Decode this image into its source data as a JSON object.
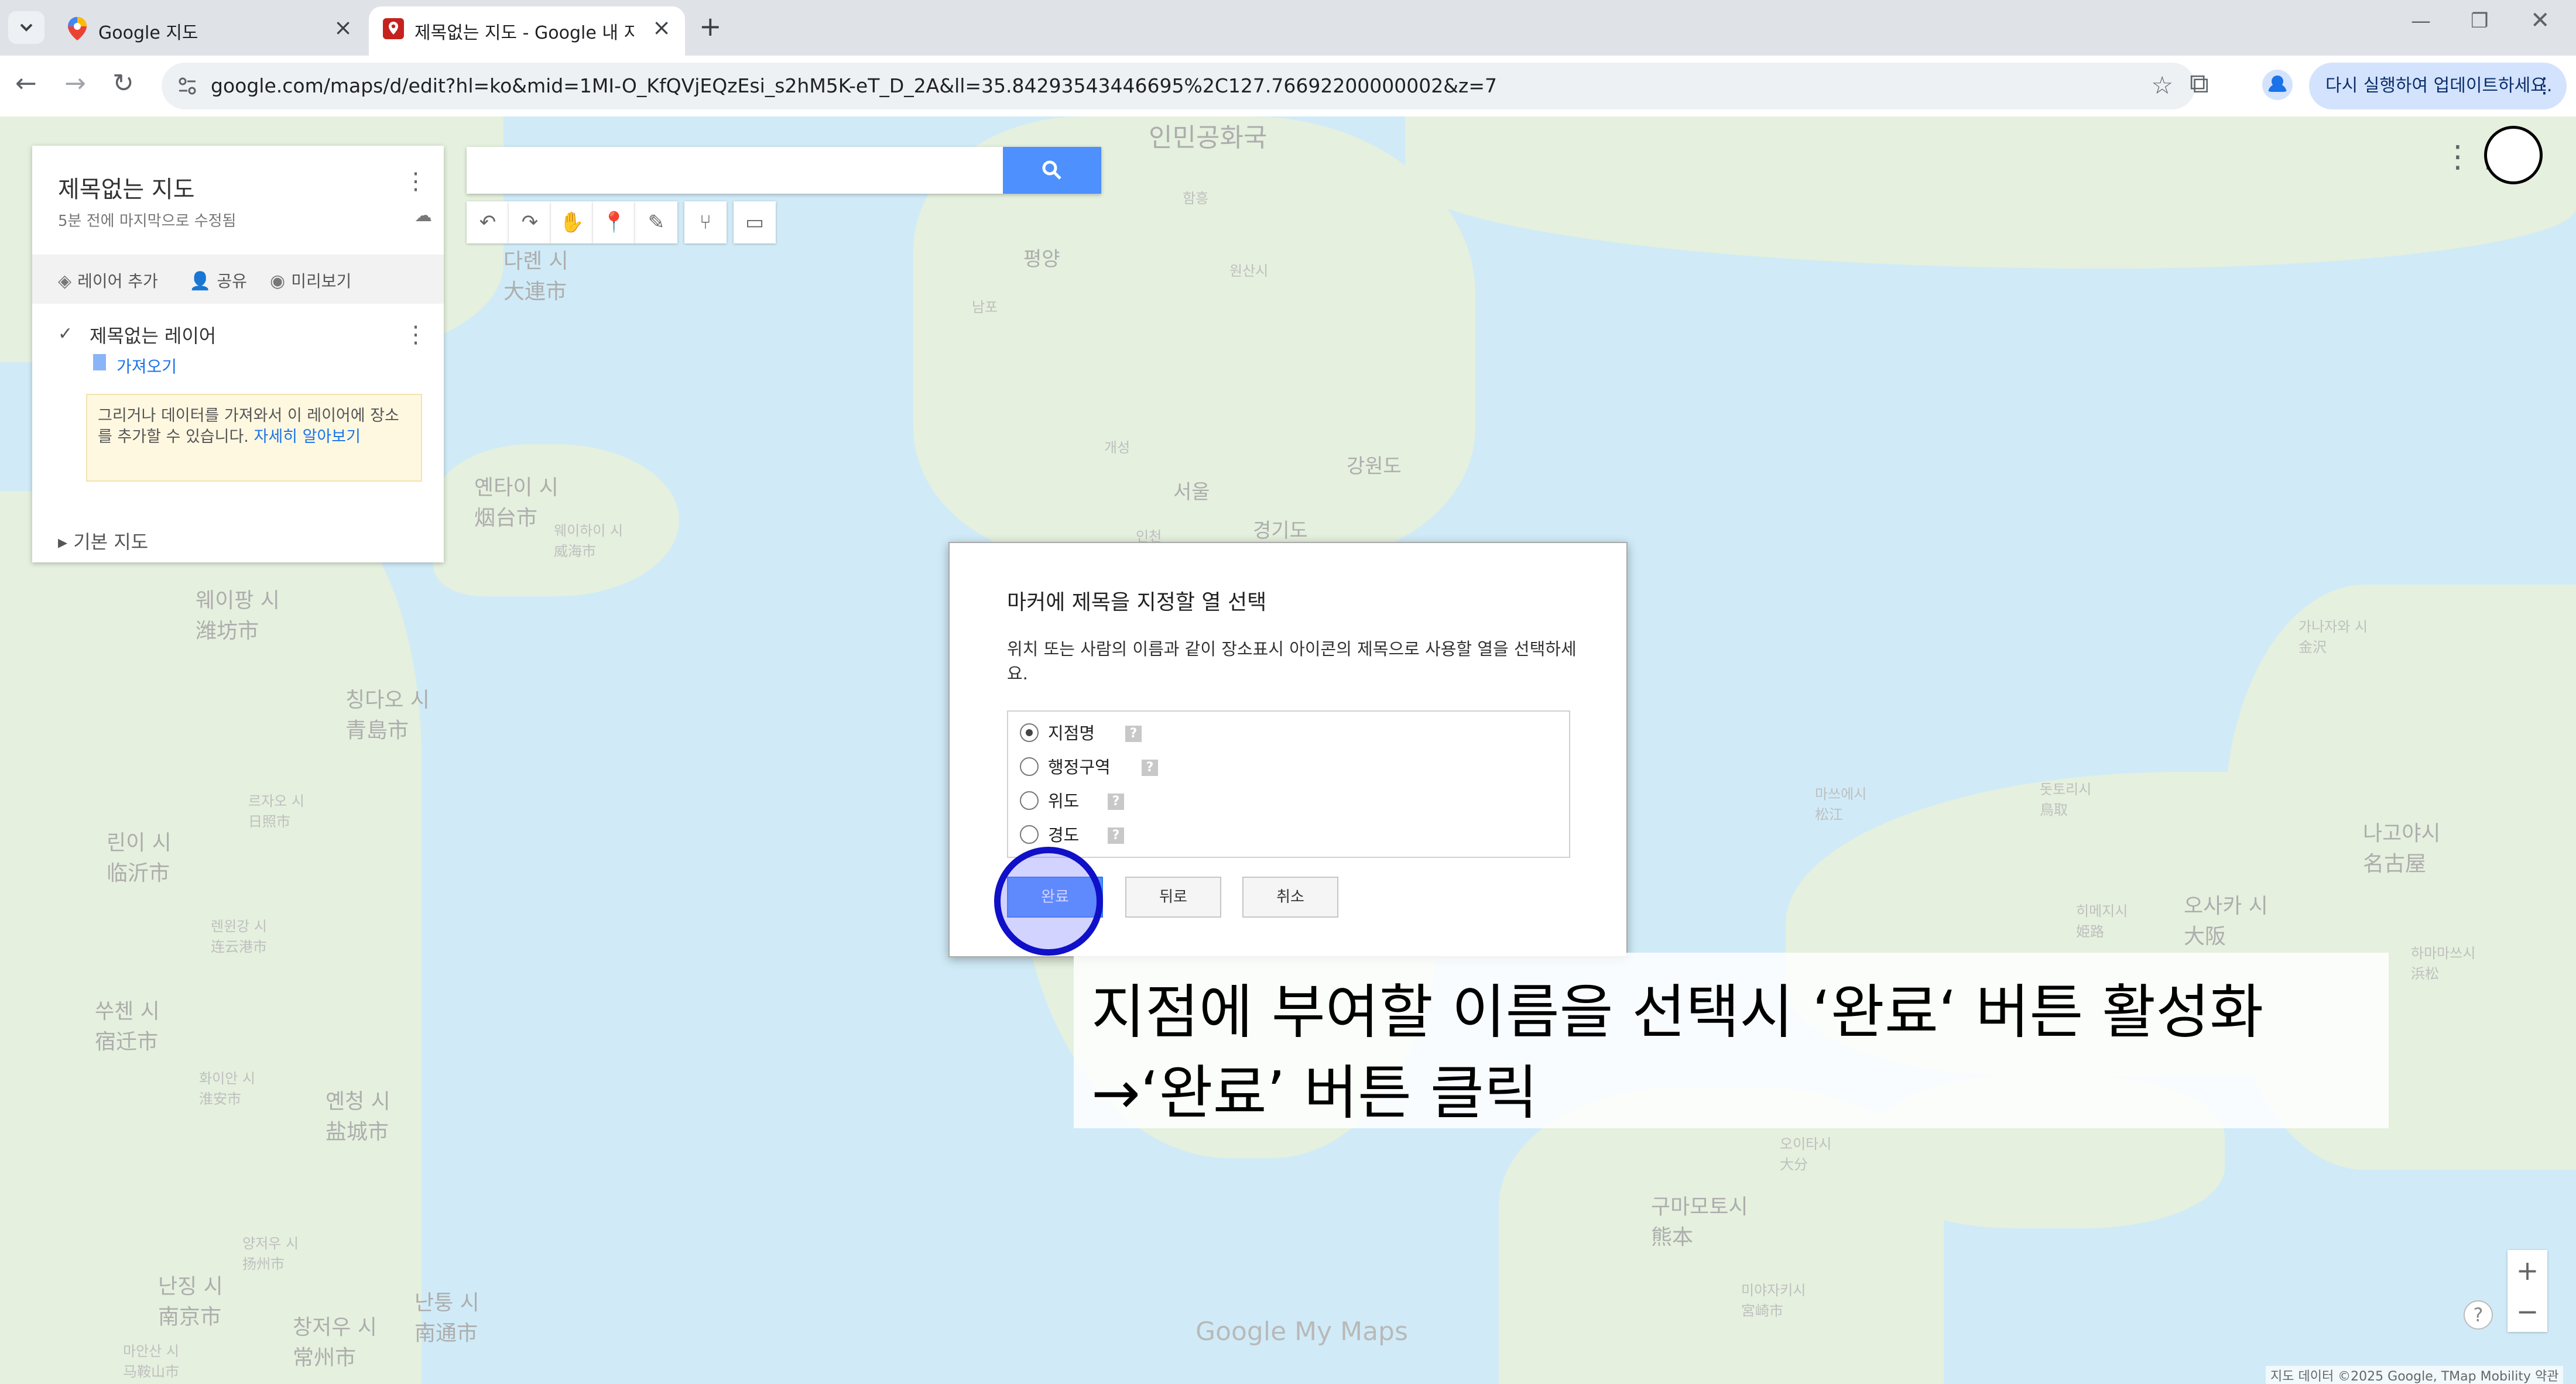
{
  "browser": {
    "tabs": [
      {
        "title": "Google 지도",
        "active": false
      },
      {
        "title": "제목없는 지도 - Google 내 지도",
        "active": true
      }
    ],
    "url": "google.com/maps/d/edit?hl=ko&mid=1MI-O_KfQVjEQzEsi_s2hM5K-eT_D_2A&ll=35.84293543446695%2C127.76692200000002&z=7",
    "update_button": "다시 실행하여 업데이트하세요."
  },
  "panel": {
    "map_title": "제목없는 지도",
    "saved_status": "5분 전에 마지막으로 수정됨",
    "actions": {
      "add_layer": "레이어 추가",
      "share": "공유",
      "preview": "미리보기"
    },
    "layer_name": "제목없는 레이어",
    "import_label": "가져오기",
    "hint_text": "그리거나 데이터를 가져와서 이 레이어에 장소를 추가할 수 있습니다.",
    "hint_link": "자세히 알아보기",
    "basemap_label": "기본 지도"
  },
  "map_labels": {
    "dalian": "다롄 시\n大連市",
    "yantai": "옌타이 시\n烟台市",
    "weihai": "웨이하이 시\n威海市",
    "weifang": "웨이팡 시\n潍坊市",
    "qingdao": "칭다오 시\n青島市",
    "rizhao": "르자오 시\n日照市",
    "linyi": "린이 시\n临沂市",
    "lianyungang": "렌윈강 시\n连云港市",
    "suqian": "쑤첸 시\n宿迁市",
    "huaian": "화이안 시\n淮安市",
    "yancheng": "옌청 시\n盐城市",
    "yangzhou": "양저우 시\n扬州市",
    "nanjing": "난징 시\n南京市",
    "nantong": "난퉁 시\n南通市",
    "changzhou": "창저우 시\n常州市",
    "maanshan": "마안산 시\n马鞍山市",
    "dprk": "인민공화국",
    "pyongyang": "평양",
    "seoul": "서울",
    "gyeonggi": "경기도",
    "gangwon": "강원도",
    "incheon": "인천",
    "kaesong": "개성",
    "wonsan": "원산시",
    "hamhung": "함흥",
    "nampo": "남포",
    "kanazawa": "가나자와 시\n金沢",
    "matsue": "마쓰에시\n松江",
    "tottori": "돗토리시\n鳥取",
    "himeji": "히메지시\n姫路",
    "osaka": "오사카 시\n大阪",
    "nagoya": "나고야시\n名古屋",
    "hamamatsu": "하마마쓰시\n浜松",
    "kumamoto": "구마모토시\n熊本",
    "oita": "오이타시\n大分",
    "miyazaki": "미야자키시\n宮崎市"
  },
  "map_brand": "Google My Maps",
  "map_credit": "지도 데이터 ©2025 Google, TMap Mobility   약관",
  "dialog": {
    "title": "마커에 제목을 지정할 열 선택",
    "description": "위치 또는 사람의 이름과 같이 장소표시 아이콘의 제목으로 사용할 열을 선택하세요.",
    "options": [
      {
        "label": "지점명",
        "selected": true
      },
      {
        "label": "행정구역",
        "selected": false
      },
      {
        "label": "위도",
        "selected": false
      },
      {
        "label": "경도",
        "selected": false
      }
    ],
    "help_glyph": "?",
    "buttons": {
      "done": "완료",
      "back": "뒤로",
      "cancel": "취소"
    }
  },
  "caption": {
    "line1": "지점에 부여할 이름을 선택시 ‘완료‘ 버튼 활성화",
    "line2": "→‘완료’ 버튼 클릭"
  },
  "colors": {
    "primary_button": "#4d90fe",
    "click_marker": "#1010c8",
    "sea": "#aadaf1",
    "land": "#cfe4c4"
  }
}
